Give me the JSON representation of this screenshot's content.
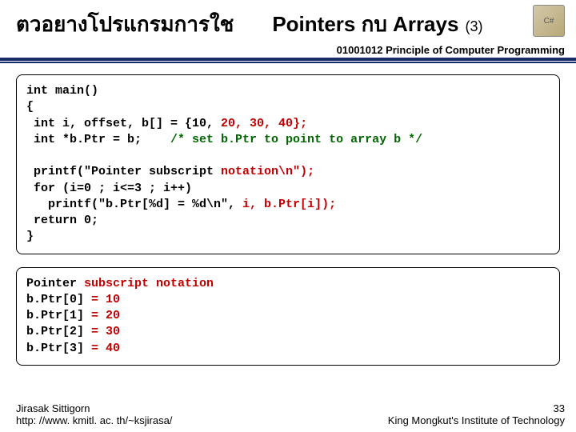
{
  "header": {
    "title_thai": "ตวอยางโปรแกรมการใช",
    "title_eng": "Pointers กบ  Arrays",
    "title_num": "(3)",
    "course": "01001012 Principle of Computer Programming",
    "icon_label": "C#"
  },
  "code_box_1": {
    "line1": "int main()",
    "line2": "{",
    "line3a": " int i, offset, b[] = {10, ",
    "line3b": "20, 30, 40};",
    "line4a": " int *b.Ptr = b;    ",
    "line4b": "/* set b.Ptr to point to array b */",
    "line5": "",
    "line6a": " printf(\"Pointer subscript ",
    "line6b": "notation\\n\");",
    "line7a": " for (i=0 ; i<=3 ; i++)",
    "line8a": "   printf(\"b.Ptr[%d] = %d\\n\", ",
    "line8b": "i, b.Ptr[i]);",
    "line9": " return 0;",
    "line10": "}"
  },
  "code_box_2": {
    "line1a": "Pointer ",
    "line1b": "subscript notation",
    "line2a": "b.Ptr[0] ",
    "line2b": "= 10",
    "line3a": "b.Ptr[1] ",
    "line3b": "= 20",
    "line4a": "b.Ptr[2] ",
    "line4b": "= 30",
    "line5a": "b.Ptr[3] ",
    "line5b": "= 40"
  },
  "footer": {
    "author": "Jirasak Sittigorn",
    "url": "http: //www. kmitl. ac. th/~ksjirasa/",
    "page_num": "33",
    "institute": "King Mongkut's Institute of Technology"
  }
}
